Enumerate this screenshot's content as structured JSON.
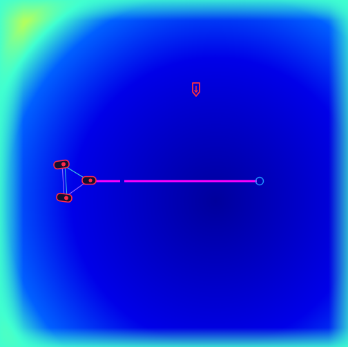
{
  "scene": {
    "background_gradient": {
      "center_color": "#00009c",
      "mid_color": "#0000e8",
      "edge_color": "#0060ff",
      "border_glow_color": "#40ffd0",
      "corner_color": "#b0ff60"
    },
    "colors": {
      "laser_beam": "#ff00ff",
      "laser_target": "#2090ff",
      "agent_outline": "#ff2a4a",
      "agent_body": "#101030",
      "link_line": "#40c8e0",
      "link_line_alt": "#9060ff",
      "marker": "#ff3040"
    },
    "icons": {
      "marker": "arrow-down-marker-icon",
      "agent": "capsule-agent-icon",
      "target": "ring-target-icon"
    }
  }
}
